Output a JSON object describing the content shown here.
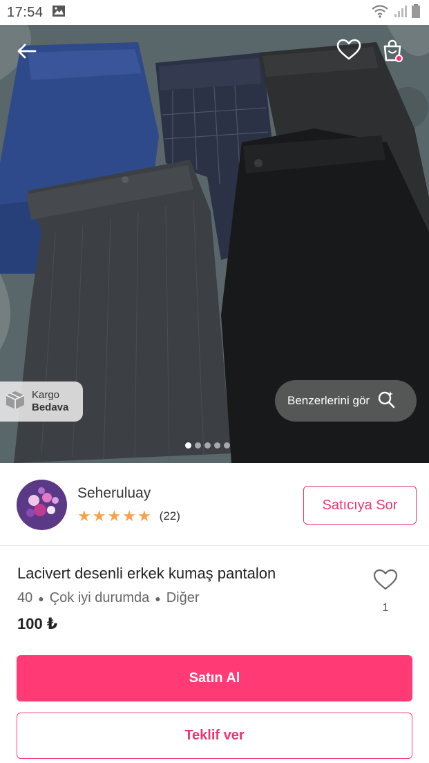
{
  "status_bar": {
    "time": "17:54"
  },
  "hero": {
    "kargo": {
      "line1": "Kargo",
      "line2": "Bedava"
    },
    "similar_label": "Benzerlerini gör",
    "image_count": 5,
    "active_image_index": 0
  },
  "seller": {
    "name": "Seheruluay",
    "rating": 5,
    "review_count": "(22)",
    "ask_label": "Satıcıya Sor"
  },
  "product": {
    "title": "Lacivert desenli erkek kumaş pantalon",
    "size": "40",
    "condition": "Çok iyi durumda",
    "brand": "Diğer",
    "price": "100 ₺",
    "like_count": "1"
  },
  "actions": {
    "buy_label": "Satın Al",
    "offer_label": "Teklif ver"
  },
  "colors": {
    "accent": "#ff3a74",
    "accent_text": "#e8386e",
    "star": "#f8a147"
  }
}
